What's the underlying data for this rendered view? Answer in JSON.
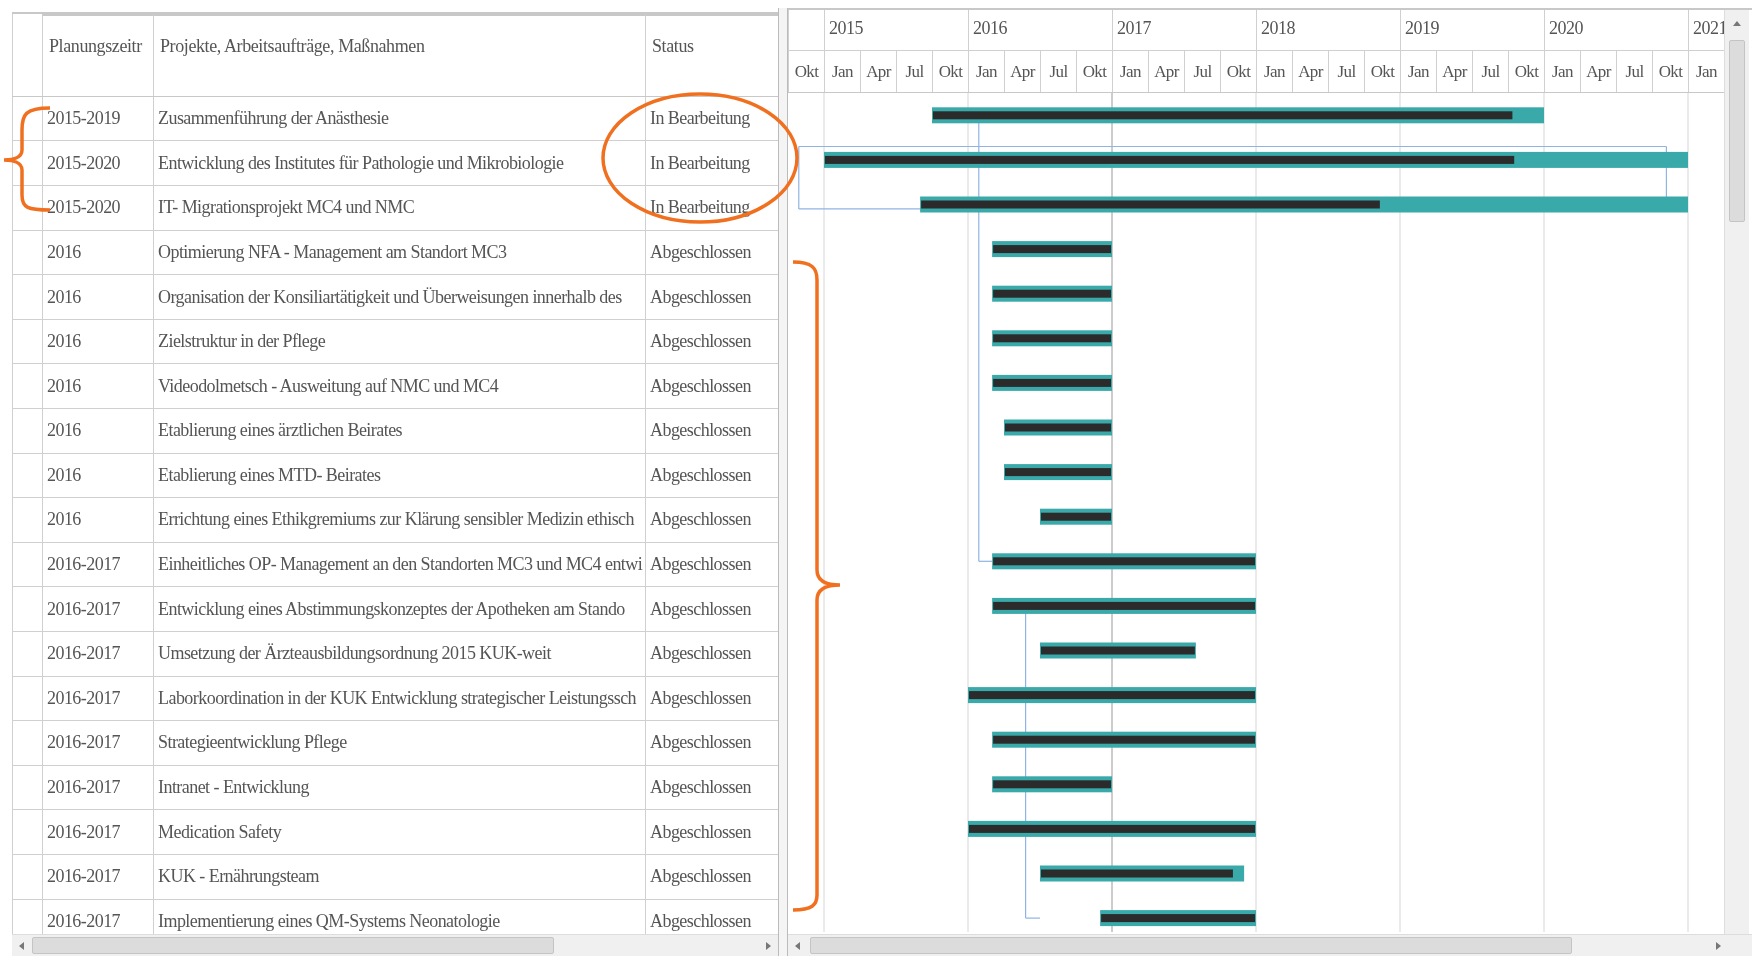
{
  "table": {
    "columns": [
      "Planungszeitr",
      "Projekte, Arbeitsaufträge, Maßnahmen",
      "Status"
    ],
    "rows": [
      {
        "period": "2015-2019",
        "project": "Zusammenführung der Anästhesie",
        "status": "In Bearbeitung"
      },
      {
        "period": "2015-2020",
        "project": "Entwicklung des Institutes für Pathologie und Mikrobiologie",
        "status": "In Bearbeitung"
      },
      {
        "period": "2015-2020",
        "project": "IT- Migrationsprojekt MC4 und NMC",
        "status": "In Bearbeitung"
      },
      {
        "period": "2016",
        "project": "Optimierung NFA - Management am Standort MC3",
        "status": "Abgeschlossen"
      },
      {
        "period": "2016",
        "project": "Organisation der Konsiliartätigkeit und Überweisungen innerhalb des",
        "status": "Abgeschlossen"
      },
      {
        "period": "2016",
        "project": "Zielstruktur in der Pflege",
        "status": "Abgeschlossen"
      },
      {
        "period": "2016",
        "project": "Videodolmetsch - Ausweitung auf NMC und MC4",
        "status": "Abgeschlossen"
      },
      {
        "period": "2016",
        "project": "Etablierung eines ärztlichen Beirates",
        "status": "Abgeschlossen"
      },
      {
        "period": "2016",
        "project": "Etablierung eines MTD- Beirates",
        "status": "Abgeschlossen"
      },
      {
        "period": "2016",
        "project": "Errichtung eines Ethikgremiums zur Klärung sensibler Medizin ethisch",
        "status": "Abgeschlossen"
      },
      {
        "period": "2016-2017",
        "project": "Einheitliches OP- Management an den Standorten MC3 und MC4 entwi",
        "status": "Abgeschlossen"
      },
      {
        "period": "2016-2017",
        "project": "Entwicklung eines Abstimmungskonzeptes der Apotheken am Stando",
        "status": "Abgeschlossen"
      },
      {
        "period": "2016-2017",
        "project": "Umsetzung der Ärzteausbildungsordnung 2015 KUK-weit",
        "status": "Abgeschlossen"
      },
      {
        "period": "2016-2017",
        "project": "Laborkoordination in der KUK Entwicklung strategischer Leistungssch",
        "status": "Abgeschlossen"
      },
      {
        "period": "2016-2017",
        "project": "Strategieentwicklung Pflege",
        "status": "Abgeschlossen"
      },
      {
        "period": "2016-2017",
        "project": "Intranet - Entwicklung",
        "status": "Abgeschlossen"
      },
      {
        "period": "2016-2017",
        "project": "Medication Safety",
        "status": "Abgeschlossen"
      },
      {
        "period": "2016-2017",
        "project": "KUK - Ernährungsteam",
        "status": "Abgeschlossen"
      },
      {
        "period": "2016-2017",
        "project": "Implementierung eines QM-Systems Neonatologie",
        "status": "Abgeschlossen"
      }
    ]
  },
  "timescale": {
    "years": [
      "2015",
      "2016",
      "2017",
      "2018",
      "2019",
      "2020",
      "2021"
    ],
    "quarters": [
      "Okt",
      "Jan",
      "Apr",
      "Jul",
      "Okt",
      "Jan",
      "Apr",
      "Jul",
      "Okt",
      "Jan",
      "Apr",
      "Jul",
      "Okt",
      "Jan",
      "Apr",
      "Jul",
      "Okt",
      "Jan",
      "Apr",
      "Jul",
      "Okt",
      "Jan",
      "Apr",
      "Jul",
      "Okt",
      "Jan"
    ]
  },
  "gantt": {
    "bars": [
      {
        "level": 0.95
      },
      {
        "level": 0.8
      },
      {
        "level": 0.6
      },
      {
        "level": 1
      },
      {
        "level": 1
      },
      {
        "level": 1
      },
      {
        "level": 1
      },
      {
        "level": 1
      },
      {
        "level": 1
      },
      {
        "level": 1
      },
      {
        "level": 1
      },
      {
        "level": 1
      },
      {
        "level": 1
      },
      {
        "level": 1
      },
      {
        "level": 1
      },
      {
        "level": 1
      },
      {
        "level": 1
      },
      {
        "level": 0.95
      },
      {
        "level": 1
      }
    ]
  }
}
